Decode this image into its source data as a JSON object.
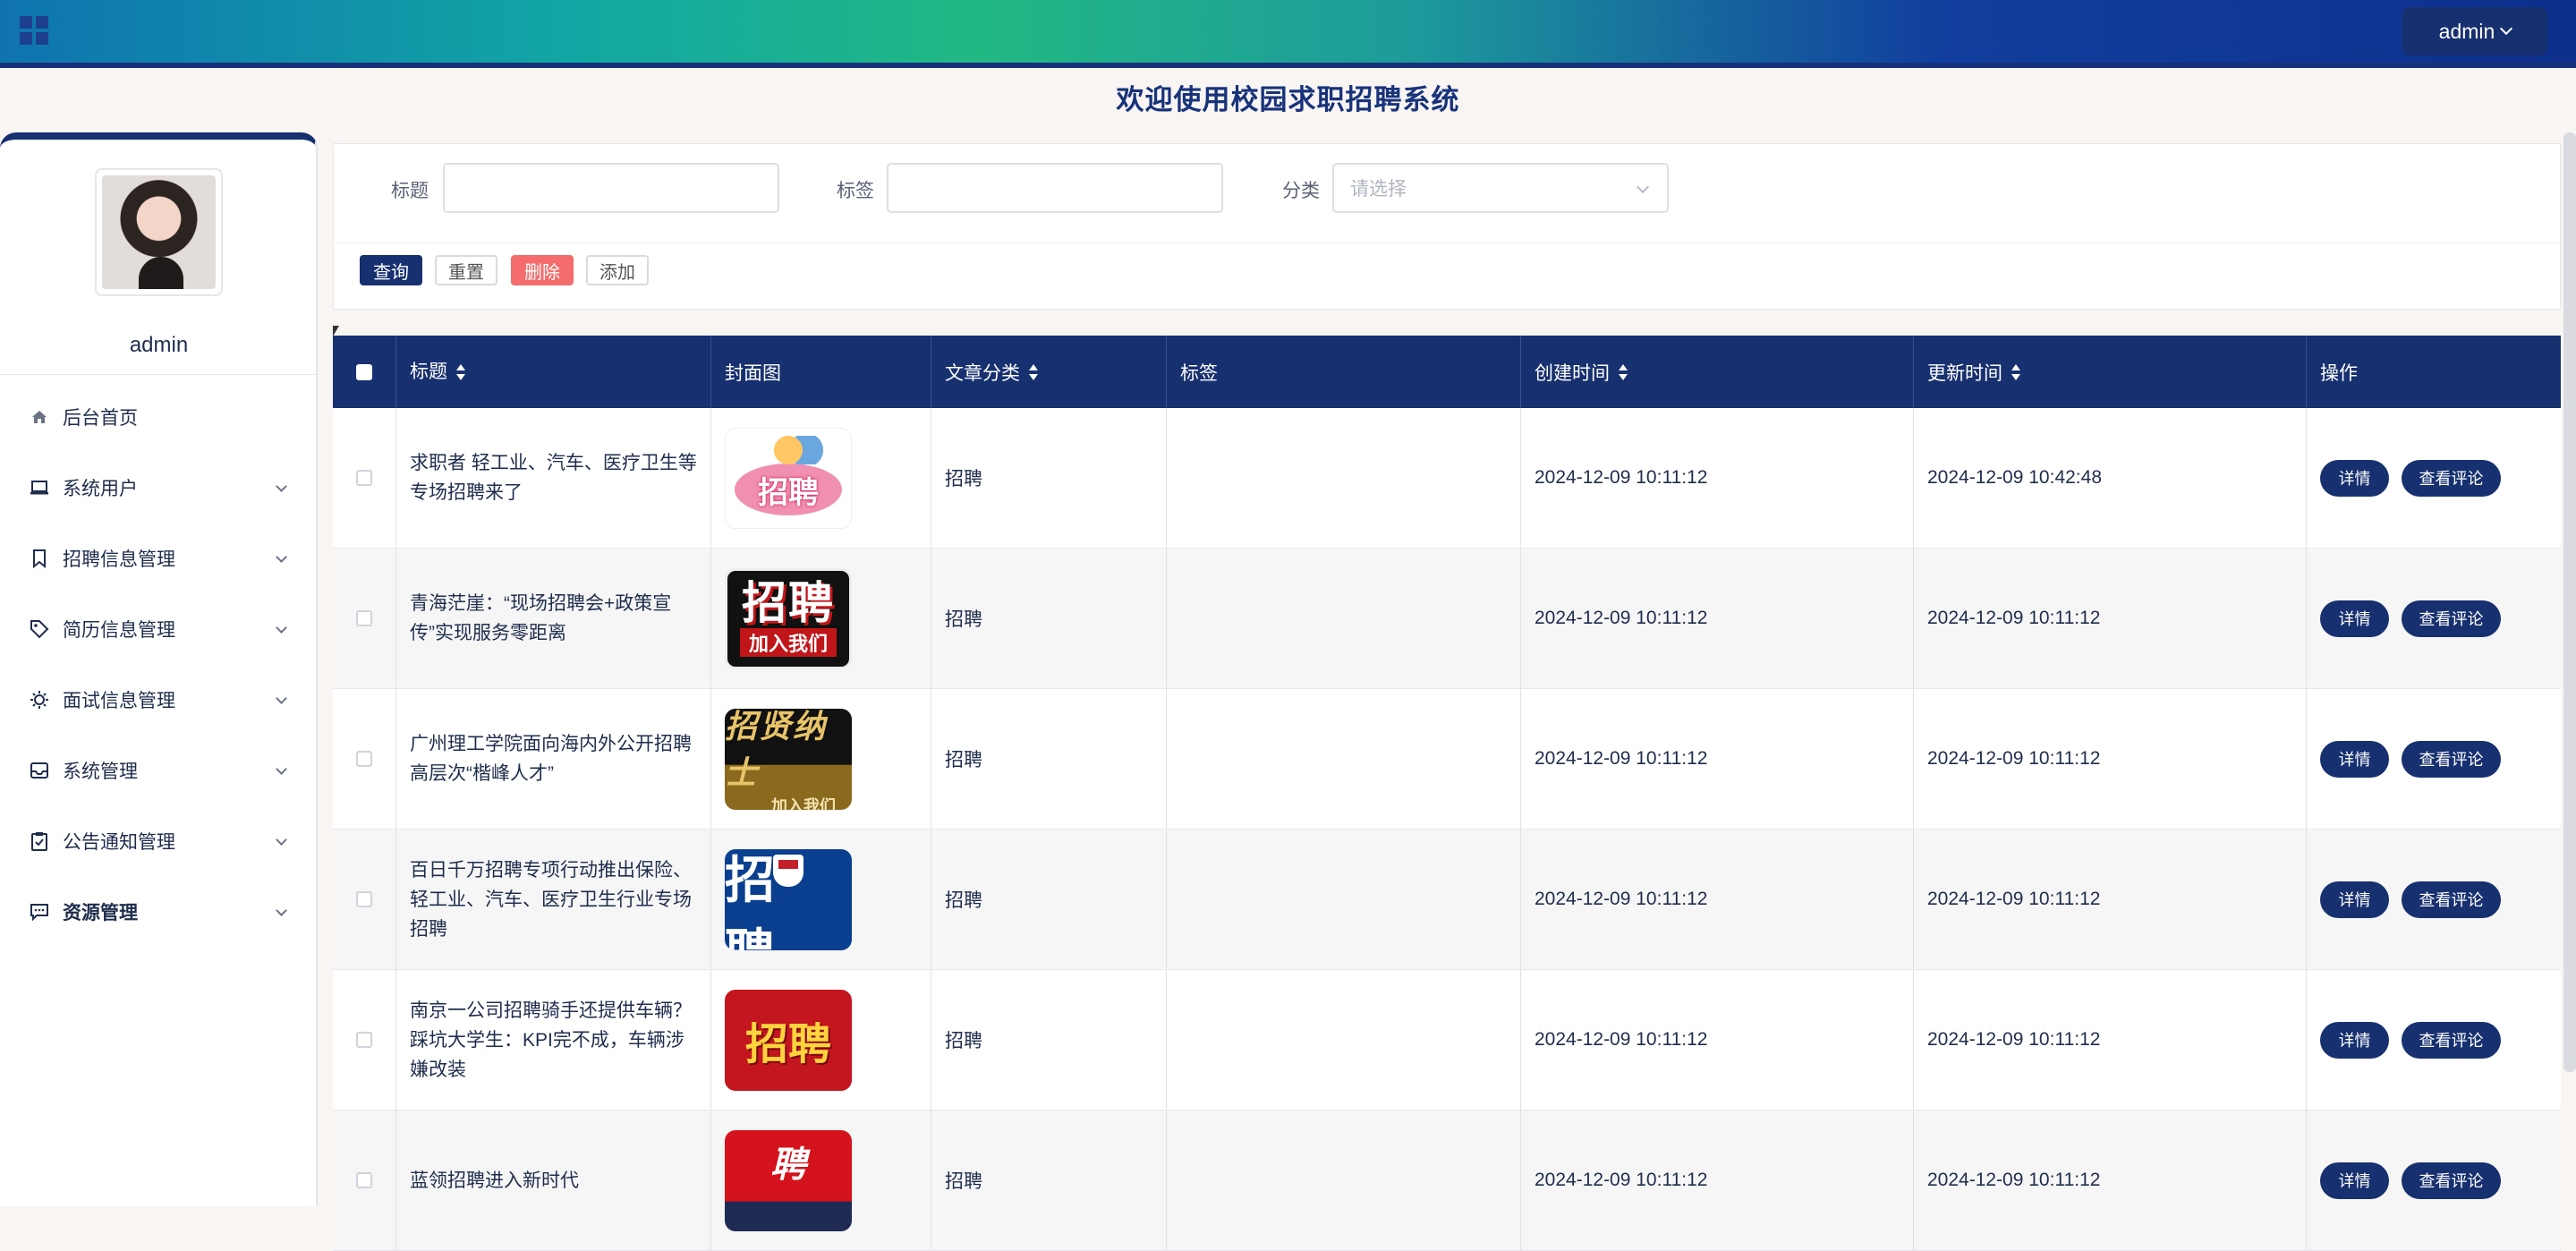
{
  "header": {
    "user_button": "admin",
    "welcome_title": "欢迎使用校园求职招聘系统"
  },
  "sidebar": {
    "username": "admin",
    "items": [
      {
        "label": "后台首页",
        "icon": "home-icon"
      },
      {
        "label": "系统用户",
        "icon": "laptop-icon"
      },
      {
        "label": "招聘信息管理",
        "icon": "bookmark-icon"
      },
      {
        "label": "简历信息管理",
        "icon": "tag-icon"
      },
      {
        "label": "面试信息管理",
        "icon": "sun-icon"
      },
      {
        "label": "系统管理",
        "icon": "inbox-icon"
      },
      {
        "label": "公告通知管理",
        "icon": "clipboard-check-icon"
      },
      {
        "label": "资源管理",
        "icon": "chat-icon"
      }
    ]
  },
  "filter": {
    "title_label": "标题",
    "tag_label": "标签",
    "category_label": "分类",
    "category_placeholder": "请选择",
    "query_button": "查询",
    "reset_button": "重置",
    "delete_button": "删除",
    "add_button": "添加"
  },
  "table": {
    "columns": [
      "标题",
      "封面图",
      "文章分类",
      "标签",
      "创建时间",
      "更新时间",
      "操作"
    ],
    "detail_button": "详情",
    "comments_button": "查看评论",
    "rows": [
      {
        "title": "求职者 轻工业、汽车、医疗卫生等专场招聘来了",
        "cover_text": "招聘",
        "category": "招聘",
        "tag": "",
        "created": "2024-12-09 10:11:12",
        "updated": "2024-12-09 10:42:48"
      },
      {
        "title": "青海茫崖：“现场招聘会+政策宣传”实现服务零距离",
        "cover_text": "招聘",
        "cover_sub": "加入我们",
        "category": "招聘",
        "tag": "",
        "created": "2024-12-09 10:11:12",
        "updated": "2024-12-09 10:11:12"
      },
      {
        "title": "广州理工学院面向海内外公开招聘高层次“楷峰人才”",
        "cover_text": "招贤纳士",
        "cover_sub": "加入我们",
        "category": "招聘",
        "tag": "",
        "created": "2024-12-09 10:11:12",
        "updated": "2024-12-09 10:11:12"
      },
      {
        "title": "百日千万招聘专项行动推出保险、轻工业、汽车、医疗卫生行业专场招聘",
        "cover_text": "招 聘",
        "category": "招聘",
        "tag": "",
        "created": "2024-12-09 10:11:12",
        "updated": "2024-12-09 10:11:12"
      },
      {
        "title": "南京一公司招聘骑手还提供车辆？踩坑大学生：KPI完不成，车辆涉嫌改装",
        "cover_text": "招聘",
        "category": "招聘",
        "tag": "",
        "created": "2024-12-09 10:11:12",
        "updated": "2024-12-09 10:11:12"
      },
      {
        "title": "蓝领招聘进入新时代",
        "cover_text": "聘",
        "category": "招聘",
        "tag": "",
        "created": "2024-12-09 10:11:12",
        "updated": "2024-12-09 10:11:12"
      }
    ]
  },
  "colors": {
    "primary": "#17306f",
    "danger": "#f56c6c"
  }
}
